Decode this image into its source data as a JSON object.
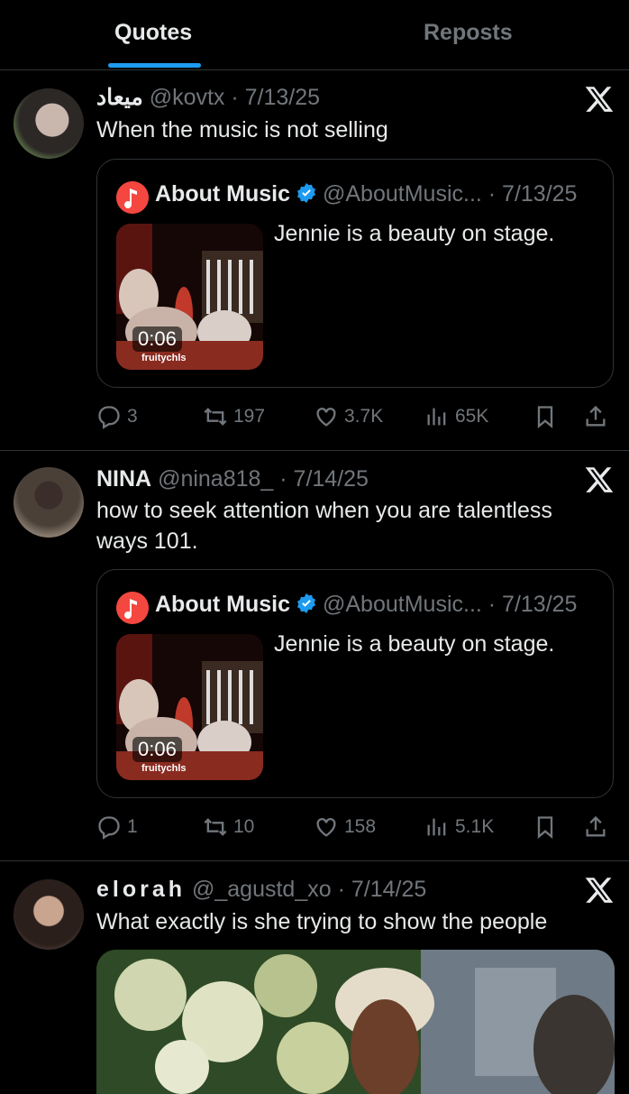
{
  "tabs": [
    {
      "label": "Quotes",
      "active": true
    },
    {
      "label": "Reposts",
      "active": false
    }
  ],
  "colors": {
    "accent": "#1d9bf0",
    "background": "#000000",
    "muted": "#71767b",
    "border": "#2f3336"
  },
  "posts": [
    {
      "display_name": "ميعاد",
      "meta": "@kovtx · 7/13/25",
      "text": "When the music is not selling",
      "quote": {
        "name": "About Music",
        "meta": "@AboutMusic... · 7/13/25",
        "text": "Jennie is a beauty on stage.",
        "duration": "0:06",
        "watermark": "fruitychls"
      },
      "actions": {
        "replies": "3",
        "reposts": "197",
        "likes": "3.7K",
        "views": "65K"
      }
    },
    {
      "display_name": "NINA",
      "meta": "@nina818_ · 7/14/25",
      "text": "how to seek attention when you are talentless ways 101.",
      "quote": {
        "name": "About Music",
        "meta": "@AboutMusic... · 7/13/25",
        "text": "Jennie is a beauty on stage.",
        "duration": "0:06",
        "watermark": "fruitychls"
      },
      "actions": {
        "replies": "1",
        "reposts": "10",
        "likes": "158",
        "views": "5.1K"
      }
    },
    {
      "display_name": "elorah",
      "meta": "@_agustd_xo · 7/14/25",
      "text": "What exactly is she trying to show the people"
    }
  ]
}
